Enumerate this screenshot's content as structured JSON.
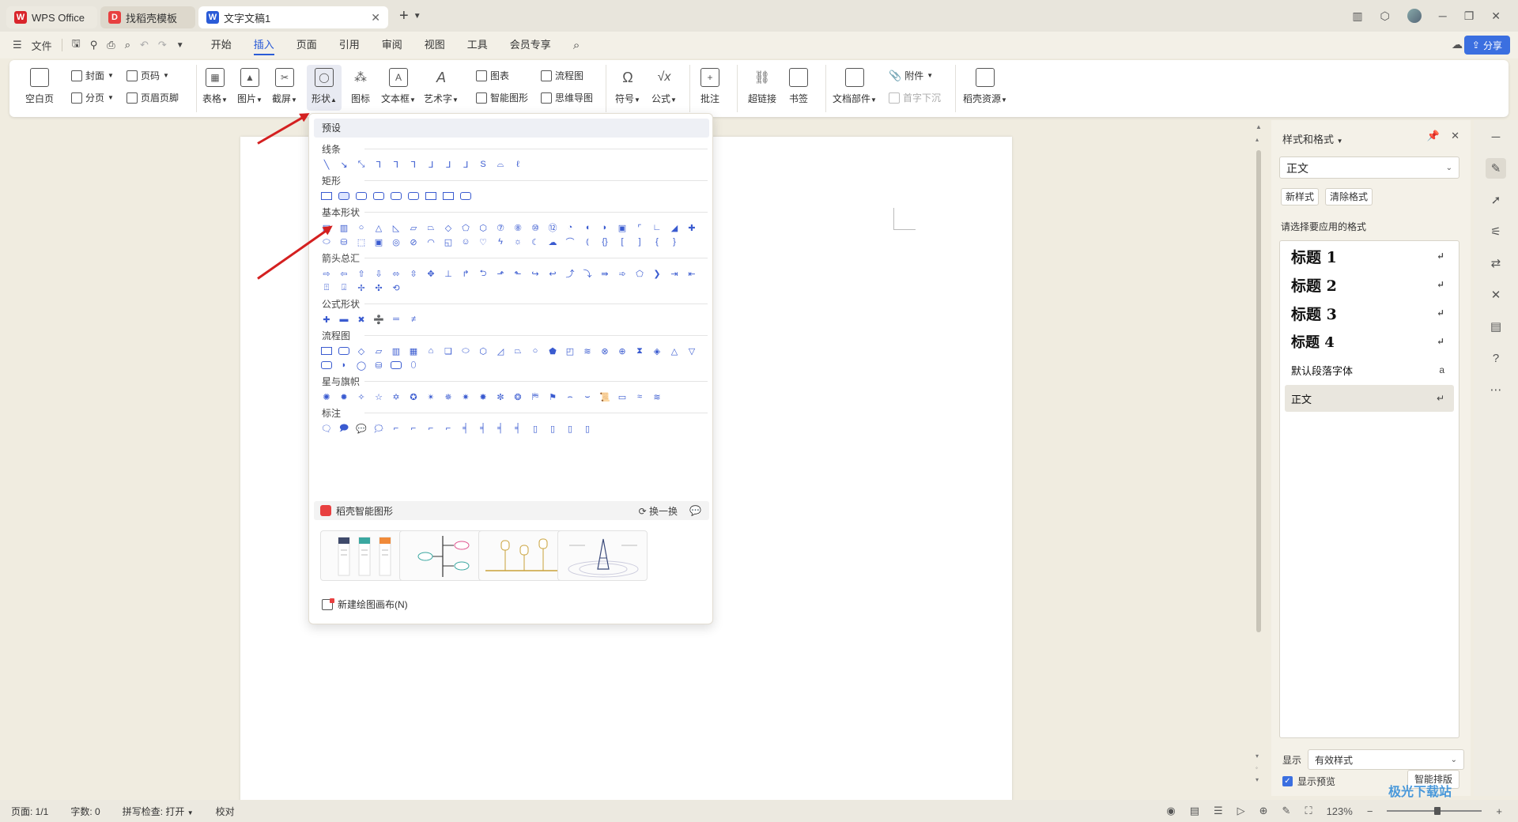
{
  "tabs": [
    {
      "label": "WPS Office"
    },
    {
      "label": "找稻壳模板"
    },
    {
      "label": "文字文稿1"
    }
  ],
  "menubar": {
    "file": "文件",
    "menus": [
      "开始",
      "插入",
      "页面",
      "引用",
      "审阅",
      "视图",
      "工具",
      "会员专享"
    ],
    "active": "插入",
    "share": "分享"
  },
  "ribbon": {
    "blank_page": "空白页",
    "cover": "封面",
    "page_break": "分页",
    "page_number": "页码",
    "header_footer": "页眉页脚",
    "table": "表格",
    "picture": "图片",
    "screenshot": "截屏",
    "shape": "形状",
    "icon": "图标",
    "textbox": "文本框",
    "wordart": "艺术字",
    "chart": "图表",
    "smartart": "智能图形",
    "flowchart": "流程图",
    "mindmap": "思维导图",
    "symbol": "符号",
    "formula": "公式",
    "comment": "批注",
    "hyperlink": "超链接",
    "bookmark": "书签",
    "doc_parts": "文档部件",
    "attachment": "附件",
    "dropcap": "首字下沉",
    "docer_res": "稻壳资源"
  },
  "shape_menu": {
    "preset": "预设",
    "sections": [
      {
        "label": "线条"
      },
      {
        "label": "矩形"
      },
      {
        "label": "基本形状"
      },
      {
        "label": "箭头总汇"
      },
      {
        "label": "公式形状"
      },
      {
        "label": "流程图"
      },
      {
        "label": "星与旗帜"
      },
      {
        "label": "标注"
      }
    ],
    "smart_title": "稻壳智能图形",
    "swap": "换一换",
    "new_canvas": "新建绘图画布(N)"
  },
  "styles_panel": {
    "title": "样式和格式",
    "current_style": "正文",
    "new_style": "新样式",
    "clear_format": "清除格式",
    "hint": "请选择要应用的格式",
    "items": [
      {
        "label": "标题  1"
      },
      {
        "label": "标题  2"
      },
      {
        "label": "标题  3"
      },
      {
        "label": "标题  4"
      },
      {
        "label": "默认段落字体"
      },
      {
        "label": "正文"
      }
    ],
    "show_label": "显示",
    "show_value": "有效样式",
    "preview": "显示预览",
    "smart_layout": "智能排版"
  },
  "statusbar": {
    "page": "页面: 1/1",
    "words": "字数: 0",
    "spell": "拼写检查: 打开",
    "proof": "校对",
    "zoom": "123%"
  },
  "watermark": "极光下载站",
  "colors": {
    "accent": "#2a5bd7",
    "shape_blue": "#3a5bd0",
    "arrow_red": "#d42020"
  }
}
